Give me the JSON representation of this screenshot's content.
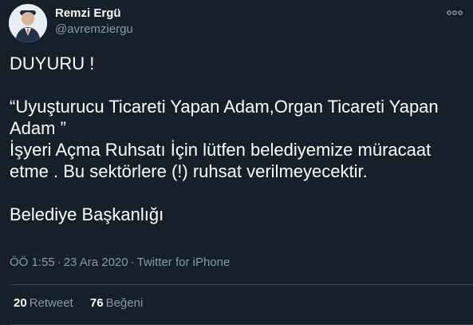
{
  "author": {
    "name": "Remzi Ergü",
    "handle": "@avremziergu",
    "avatar_icon": "person-avatar-icon"
  },
  "more_icon": "more-options-icon",
  "tweet": {
    "lines": [
      "DUYURU !",
      "",
      "“Uyuşturucu Ticareti Yapan Adam,Organ Ticareti Yapan",
      "Adam ”",
      "İşyeri Açma Ruhsatı İçin lütfen belediyemize müracaat",
      "etme . Bu sektörlere (!) ruhsat verilmeyecektir.",
      "",
      "Belediye Başkanlığı"
    ]
  },
  "meta": {
    "time": "ÖÖ 1:55",
    "separator": "·",
    "date": "23 Ara 2020",
    "source": "Twitter for iPhone"
  },
  "stats": {
    "retweets_count": "20",
    "retweets_label": "Retweet",
    "likes_count": "76",
    "likes_label": "Beğeni"
  },
  "colors": {
    "background": "#15202b",
    "text": "#ffffff",
    "secondary": "#8899a6",
    "divider": "#38444d"
  }
}
